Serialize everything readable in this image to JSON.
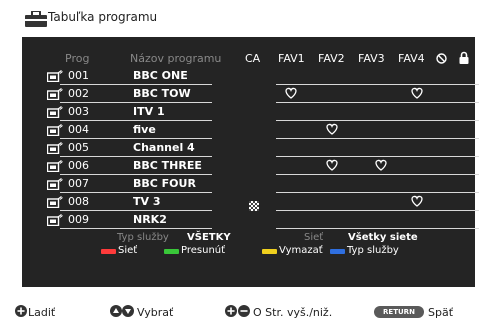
{
  "window": {
    "title": "Tabuľka programu",
    "icon": "toolbox-icon"
  },
  "columns": {
    "prog": "Prog",
    "name": "Názov programu",
    "ca": "CA",
    "fav1": "FAV1",
    "fav2": "FAV2",
    "fav3": "FAV3",
    "fav4": "FAV4",
    "skip_icon": "prohibited-icon",
    "lock_icon": "lock-icon"
  },
  "channels": [
    {
      "num": "001",
      "name": "BBC ONE"
    },
    {
      "num": "002",
      "name": "BBC TOW"
    },
    {
      "num": "003",
      "name": "ITV 1"
    },
    {
      "num": "004",
      "name": "five"
    },
    {
      "num": "005",
      "name": "Channel 4"
    },
    {
      "num": "006",
      "name": "BBC THREE"
    },
    {
      "num": "007",
      "name": "BBC FOUR"
    },
    {
      "num": "008",
      "name": "TV 3"
    },
    {
      "num": "009",
      "name": "NRK2"
    }
  ],
  "favorites": {
    "002": [
      "fav1",
      "fav4"
    ],
    "004": [
      "fav2"
    ],
    "006": [
      "fav2",
      "fav3"
    ],
    "008": [
      "fav4"
    ]
  },
  "ca_marked": [
    "008"
  ],
  "filters": {
    "service_type_label": "Typ služby",
    "service_type_value": "VŠETKY",
    "network_label": "Sieť",
    "network_value": "Všetky siete"
  },
  "color_keys": [
    {
      "color": "#ff3b3b",
      "label": "Sieť"
    },
    {
      "color": "#39c739",
      "label": "Presunúť"
    },
    {
      "color": "#f0d01e",
      "label": "Vymazať"
    },
    {
      "color": "#2f6fe0",
      "label": "Typ služby"
    }
  ],
  "footer": {
    "tune": "Ladiť",
    "select": "Vybrať",
    "page": "O Str. vyš./niž.",
    "return_btn": "RETURN",
    "back": "Späť"
  },
  "colors": {
    "panel": "#242424",
    "accent_line": "#d8d8d8",
    "dim_text": "#888888"
  }
}
